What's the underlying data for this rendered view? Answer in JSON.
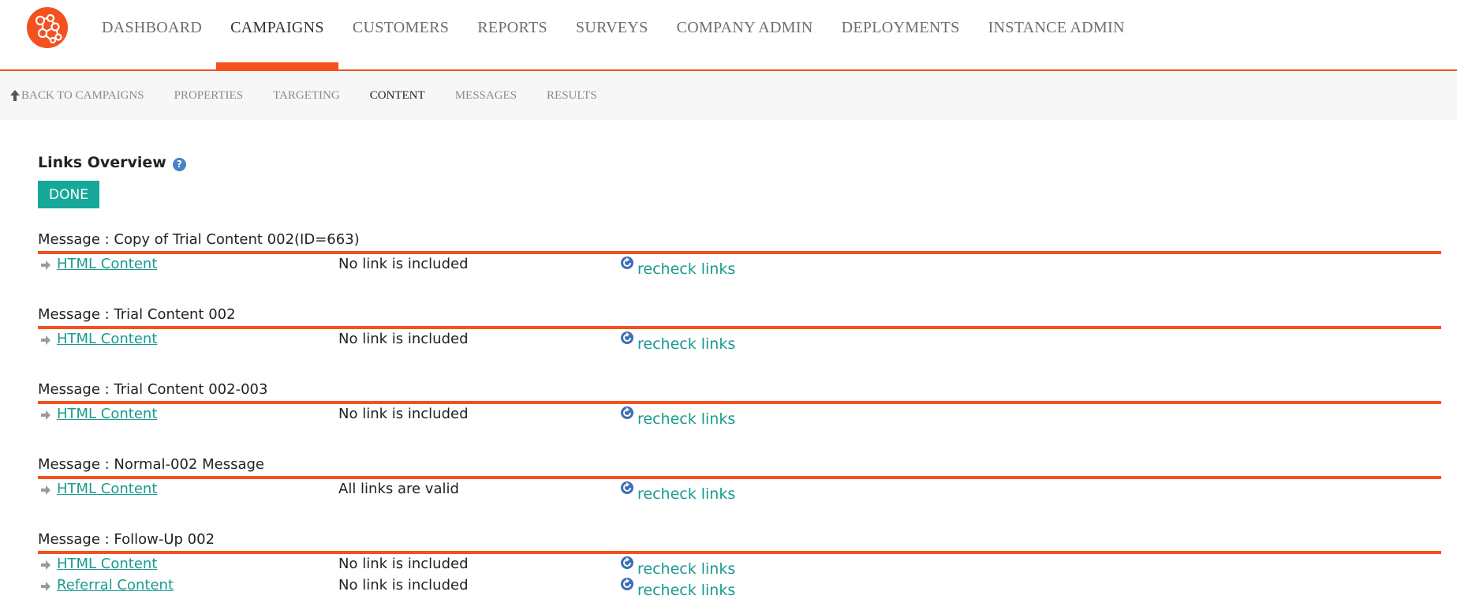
{
  "nav": {
    "items": [
      {
        "label": "DASHBOARD",
        "active": false
      },
      {
        "label": "CAMPAIGNS",
        "active": true
      },
      {
        "label": "CUSTOMERS",
        "active": false
      },
      {
        "label": "REPORTS",
        "active": false
      },
      {
        "label": "SURVEYS",
        "active": false
      },
      {
        "label": "COMPANY ADMIN",
        "active": false
      },
      {
        "label": "DEPLOYMENTS",
        "active": false
      },
      {
        "label": "INSTANCE ADMIN",
        "active": false
      }
    ]
  },
  "subnav": {
    "back_label": "BACK TO CAMPAIGNS",
    "items": [
      {
        "label": "PROPERTIES",
        "active": false
      },
      {
        "label": "TARGETING",
        "active": false
      },
      {
        "label": "CONTENT",
        "active": true
      },
      {
        "label": "MESSAGES",
        "active": false
      },
      {
        "label": "RESULTS",
        "active": false
      }
    ]
  },
  "page": {
    "title": "Links Overview",
    "help_glyph": "?",
    "done_label": "DONE"
  },
  "messages": [
    {
      "title": "Message : Copy of Trial Content 002(ID=663)",
      "rows": [
        {
          "content": "HTML Content",
          "status": "No link is included",
          "action": "recheck links"
        }
      ]
    },
    {
      "title": "Message : Trial Content 002",
      "rows": [
        {
          "content": "HTML Content",
          "status": "No link is included",
          "action": "recheck links"
        }
      ]
    },
    {
      "title": "Message : Trial Content 002-003",
      "rows": [
        {
          "content": "HTML Content",
          "status": "No link is included",
          "action": "recheck links"
        }
      ]
    },
    {
      "title": "Message : Normal-002 Message",
      "rows": [
        {
          "content": "HTML Content",
          "status": "All links are valid",
          "action": "recheck links"
        }
      ]
    },
    {
      "title": "Message : Follow-Up 002",
      "rows": [
        {
          "content": "HTML Content",
          "status": "No link is included",
          "action": "recheck links"
        },
        {
          "content": "Referral Content",
          "status": "No link is included",
          "action": "recheck links"
        }
      ]
    }
  ],
  "colors": {
    "accent": "#f4511e",
    "teal": "#17a89a",
    "link": "#1a9a90"
  },
  "icons": {
    "logo": "network-logo-icon",
    "help": "help-icon",
    "bullet": "arrow-right-icon",
    "refresh": "refresh-icon",
    "back": "arrow-up-icon"
  }
}
